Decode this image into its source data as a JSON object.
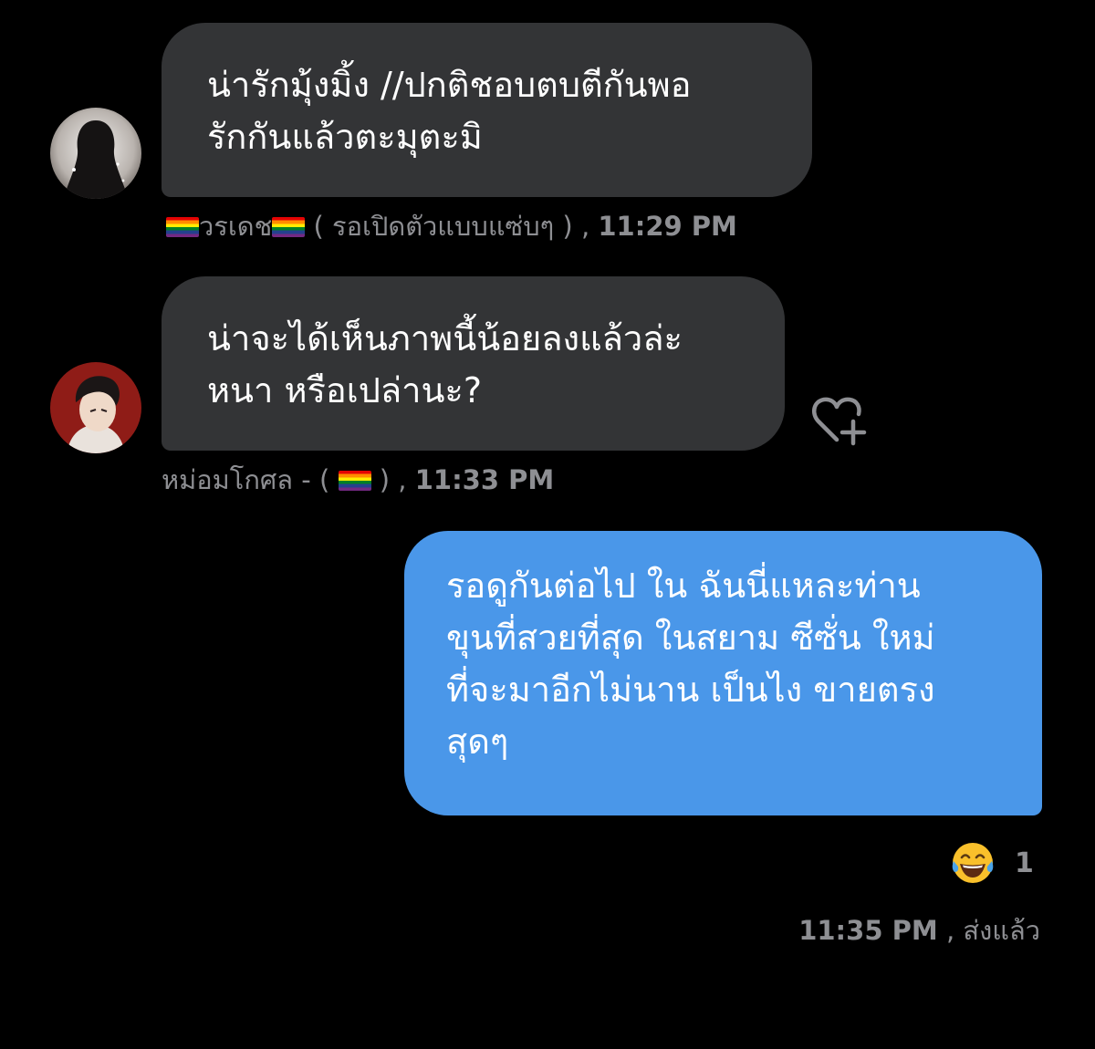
{
  "messages": [
    {
      "direction": "incoming",
      "lines": [
        "น่ารักมุ้งมิ้ง //ปกติชอบตบตีกันพอ",
        "รักกันแล้วตะมุตะมิ"
      ],
      "sender_name": "วรเดช",
      "sender_note": " ( รอเปิดตัวแบบแซ่บๆ ) ",
      "time": "11:29 PM"
    },
    {
      "direction": "incoming",
      "lines": [
        "น่าจะได้เห็นภาพนี้น้อยลงแล้วล่ะ",
        "หนา หรือเปล่านะ?"
      ],
      "sender_name": "หม่อมโกศล - ( ",
      "sender_note": " ) ",
      "time": "11:33 PM"
    },
    {
      "direction": "outgoing",
      "lines": [
        "รอดูกันต่อไป  ใน ฉันนี่แหละท่าน",
        "ขุนที่สวยที่สุด ในสยาม ซีซั่น ใหม่",
        "ที่จะมาอีกไม่นาน  เป็นไง ขายตรง",
        "สุดๆ"
      ],
      "reaction_emoji": "😂",
      "reaction_count": "1",
      "time": "11:35 PM",
      "status": "ส่งแล้ว"
    }
  ],
  "separator": ",",
  "icons": {
    "add_reaction": "heart-plus-icon",
    "flag": "rainbow-flag-icon"
  },
  "colors": {
    "background": "#000000",
    "incoming_bubble": "#333436",
    "outgoing_bubble": "#4a97e9",
    "meta_text": "#8e8f93"
  }
}
